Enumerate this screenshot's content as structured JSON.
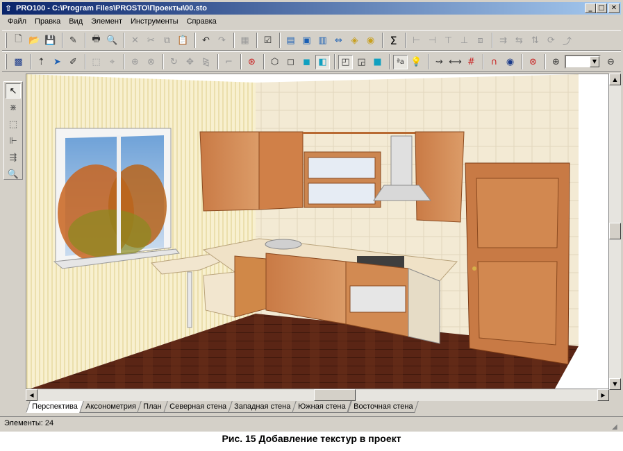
{
  "window": {
    "title": "PRO100 - C:\\Program Files\\PROSTO\\Проекты\\00.sto"
  },
  "menu": [
    "Файл",
    "Правка",
    "Вид",
    "Элемент",
    "Инструменты",
    "Справка"
  ],
  "toolbar1": {
    "icons": [
      "new-file-icon",
      "open-folder-icon",
      "save-icon",
      "edit-icon",
      "print-icon",
      "print-preview-icon",
      "delete-icon",
      "cut-icon",
      "copy-icon",
      "paste-icon",
      "undo-icon",
      "redo-icon",
      "properties-icon",
      "checklist-icon",
      "report-icon",
      "report-search-icon",
      "report-list-icon",
      "report-size-icon",
      "report-light-icon",
      "report-money-icon",
      "sum-icon",
      "align-left-icon",
      "align-h-center-icon",
      "align-top-icon",
      "align-bottom-icon",
      "group-icon",
      "distribute-h-icon",
      "distribute-v-icon",
      "space-icon",
      "rotate-icon",
      "export-icon"
    ],
    "sum_label": "Σ"
  },
  "toolbar2": {
    "icons": [
      "grid-icon",
      "move-up-icon",
      "select-pointer-icon",
      "pencil-icon",
      "frame-icon",
      "rotate-around-icon",
      "rotate-axis-icon",
      "rotate-cw-icon",
      "pan-icon",
      "mirror-icon",
      "corner-icon",
      "target-icon",
      "box-wire-icon",
      "box-outline-icon",
      "box-color-icon",
      "box-texture-icon",
      "box-back-icon",
      "box-front-icon",
      "box-solid-icon",
      "text-aa-icon",
      "light-bulb-icon",
      "walk-icon",
      "dimension-icon",
      "grid-red-icon",
      "magnet-icon",
      "snap-icon",
      "target2-icon",
      "zoom-in-icon",
      "zoom-out-icon"
    ],
    "text_aa": "ªa",
    "zoom_value": ""
  },
  "palette": [
    "pointer-icon",
    "trim-icon",
    "box-icon",
    "align-tool-icon",
    "arrange-icon",
    "zoom-tool-icon"
  ],
  "tabs": [
    "Перспектива",
    "Аксонометрия",
    "План",
    "Северная стена",
    "Западная стена",
    "Южная стена",
    "Восточная стена"
  ],
  "active_tab": 0,
  "status": "Элементы: 24",
  "caption": "Рис. 15  Добавление текстур в проект",
  "colors": {
    "wood_light": "#d89a66",
    "wood_mid": "#c9834a",
    "wood_dark": "#b5632f",
    "floor": "#5b2614",
    "wall_stripe": "#f6eec8",
    "tile": "#f4ecd6"
  }
}
